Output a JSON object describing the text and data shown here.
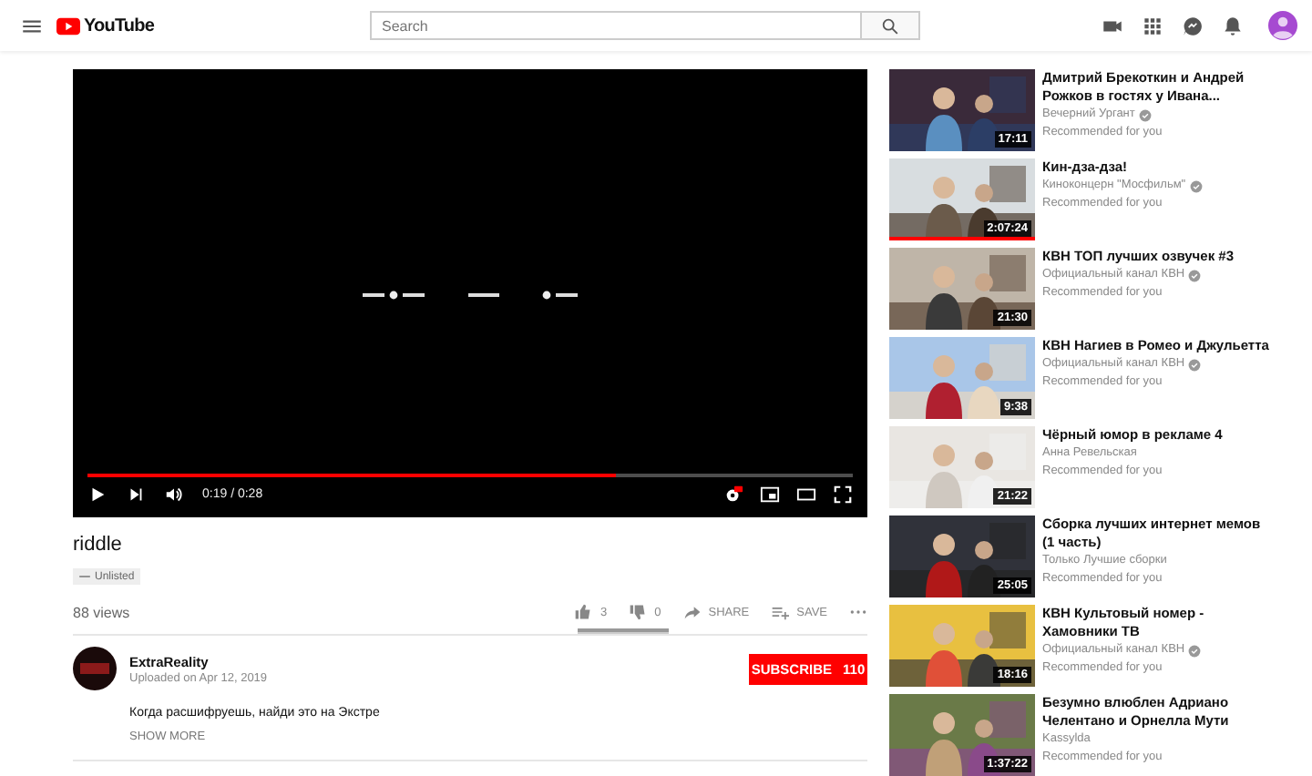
{
  "header": {
    "logo": "YouTube",
    "search": {
      "placeholder": "Search"
    }
  },
  "player": {
    "progress": {
      "level": 0.69
    },
    "time": "0:19 / 0:28"
  },
  "video": {
    "title": "riddle",
    "badge": "Unlisted",
    "views": "88 views",
    "actions": [
      {
        "kind": "like",
        "label": "3"
      },
      {
        "kind": "dislike",
        "label": "0"
      },
      {
        "kind": "share",
        "label": "SHARE"
      },
      {
        "kind": "save",
        "label": "SAVE"
      },
      {
        "kind": "more"
      }
    ],
    "sentiment": {
      "level": 1
    }
  },
  "channel": {
    "name": "ExtraReality",
    "uploaded": "Uploaded on Apr 12, 2019",
    "subscribe": "SUBSCRIBE",
    "subscribers": "110"
  },
  "description": {
    "text": "Когда расшифруешь, найди это на Экстре",
    "show_more": "SHOW MORE"
  },
  "recommendations": [
    {
      "title": "Дмитрий Брекоткин и Андрей Рожков в гостях у Ивана...",
      "channel": "Вечерний Ургант",
      "verified": true,
      "note": "Recommended for you",
      "duration": "17:11"
    },
    {
      "title": "Кин-дза-дза!",
      "channel": "Киноконцерн \"Мосфильм\"",
      "verified": true,
      "note": "Recommended for you",
      "duration": "2:07:24",
      "level": 1
    },
    {
      "title": "КВН ТОП лучших озвучек #3",
      "channel": "Официальный канал КВН",
      "verified": true,
      "note": "Recommended for you",
      "duration": "21:30"
    },
    {
      "title": "КВН Нагиев в Ромео и Джульетта",
      "channel": "Официальный канал КВН",
      "verified": true,
      "note": "Recommended for you",
      "duration": "9:38"
    },
    {
      "title": "Чёрный юмор в рекламе 4",
      "channel": "Анна Ревельская",
      "verified": false,
      "note": "Recommended for you",
      "duration": "21:22"
    },
    {
      "title": "Сборка лучших интернет мемов (1 часть)",
      "channel": "Только Лучшие сборки",
      "verified": false,
      "note": "Recommended for you",
      "duration": "25:05"
    },
    {
      "title": "КВН Культовый номер - Хамовники ТВ",
      "channel": "Официальный канал КВН",
      "verified": true,
      "note": "Recommended for you",
      "duration": "18:16"
    },
    {
      "title": "Безумно влюблен Адриано Челентано и Орнелла Мути",
      "channel": "Kassylda",
      "verified": false,
      "note": "Recommended for you",
      "duration": "1:37:22"
    }
  ]
}
